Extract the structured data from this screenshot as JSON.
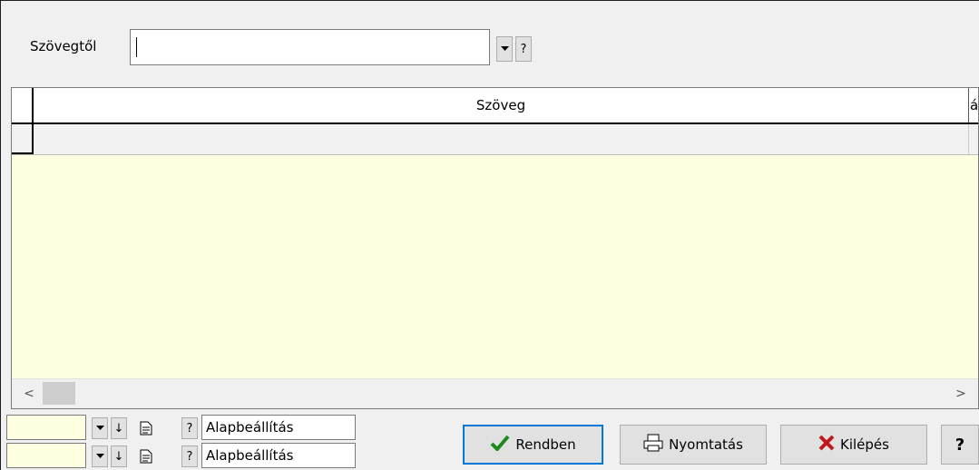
{
  "filter": {
    "label": "Szövegtől",
    "value": "",
    "dropdown_icon": "chevron-down-icon",
    "help_label": "?"
  },
  "grid": {
    "columns": [
      "Szöveg",
      "á"
    ],
    "rows": [
      [
        "",
        ""
      ]
    ]
  },
  "bottom_rows": [
    {
      "value": "",
      "sort_icon": "↓",
      "doc_icon": "document-icon",
      "help": "?",
      "preset": "Alapbeállítás"
    },
    {
      "value": "",
      "sort_icon": "↓",
      "doc_icon": "document-icon",
      "help": "?",
      "preset": "Alapbeállítás"
    }
  ],
  "buttons": {
    "ok": "Rendben",
    "print": "Nyomtatás",
    "exit": "Kilépés",
    "help": "?"
  },
  "scroll": {
    "left": "<",
    "right": ">"
  }
}
